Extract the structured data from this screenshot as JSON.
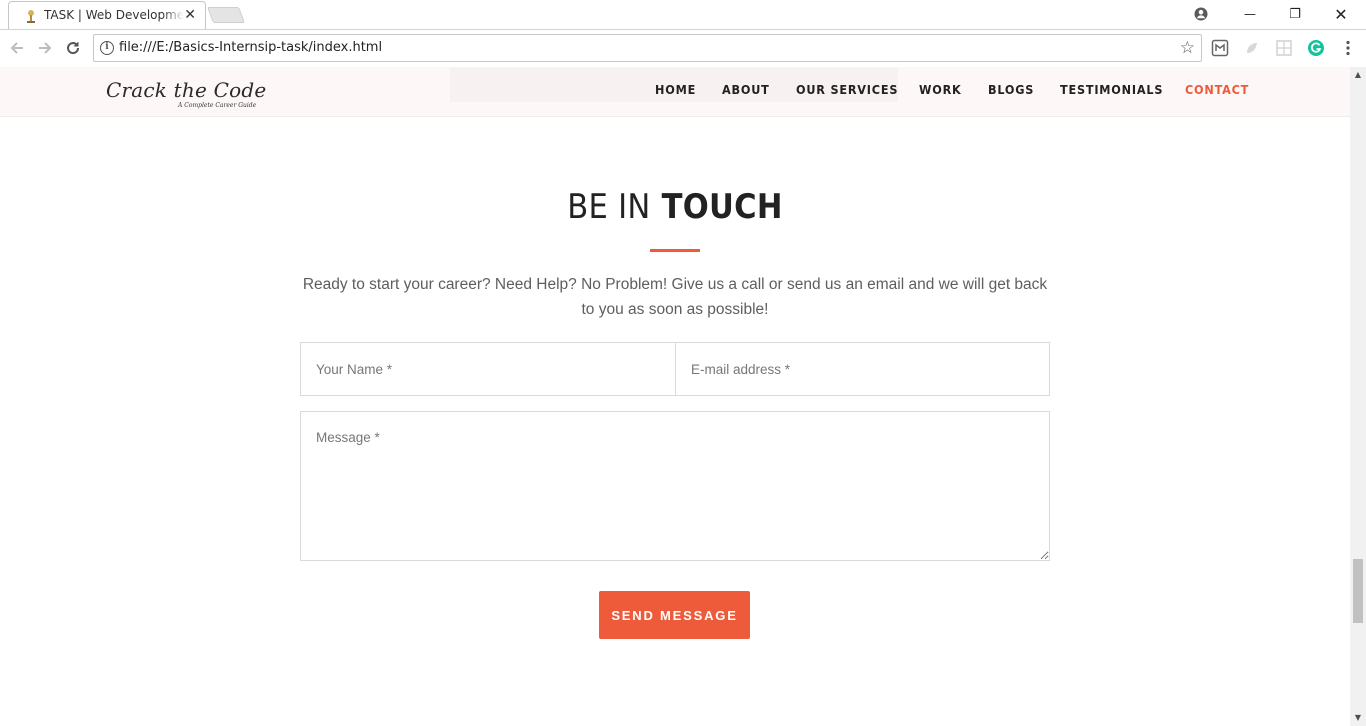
{
  "browser": {
    "tab_title": "TASK | Web Development",
    "tab_close": "✕",
    "url": "file:///E:/Basics-Internsip-task/index.html",
    "info_glyph": "i",
    "star_glyph": "☆",
    "controls": {
      "minimize": "—",
      "restore": "❐",
      "close": "✕"
    },
    "icons": [
      "back-arrow-icon",
      "forward-arrow-icon",
      "reload-icon",
      "account-icon",
      "grammarly-icon"
    ],
    "accent": "#15c39a"
  },
  "header": {
    "logo_title": "Crack the Code",
    "logo_tagline": "A Complete Career Guide",
    "menu": [
      {
        "label": "HOME",
        "active": false
      },
      {
        "label": "ABOUT",
        "active": false
      },
      {
        "label": "OUR SERVICES",
        "active": false
      },
      {
        "label": "WORK",
        "active": false
      },
      {
        "label": "BLOGS",
        "active": false
      },
      {
        "label": "TESTIMONIALS",
        "active": false
      },
      {
        "label": "CONTACT",
        "active": true
      }
    ]
  },
  "contact": {
    "heading_light": "BE IN",
    "heading_bold": "TOUCH",
    "lead": "Ready to start your career? Need Help? No Problem! Give us a call or send us an email and we will get back to you as soon as possible!",
    "name_placeholder": "Your Name *",
    "email_placeholder": "E-mail address *",
    "message_placeholder": "Message *",
    "send_label": "SEND MESSAGE"
  },
  "colors": {
    "accent": "#ee5b3a",
    "header_bg": "#fdf8f7",
    "text_dark": "#222222",
    "text_muted": "#5e5e5e"
  }
}
